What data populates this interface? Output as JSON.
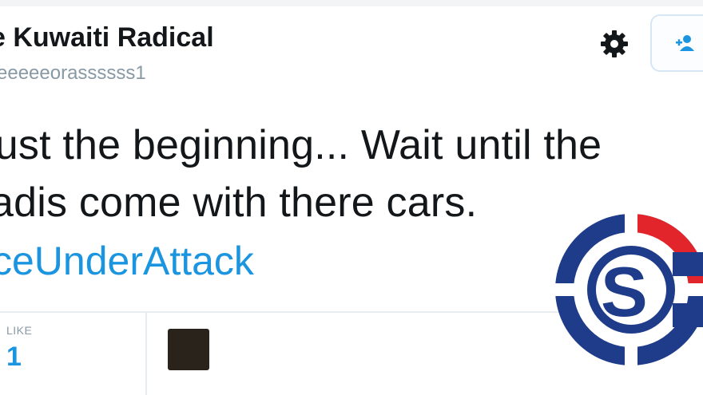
{
  "tweet": {
    "display_name": "e Kuwaiti Radical",
    "handle": "eeeeeorassssss1",
    "text_line_1": "just the beginning... Wait until the",
    "text_line_2": "adis come with there cars.",
    "hashtag": "ceUnderAttack",
    "likes_label": "LIKE",
    "likes_count": "1"
  },
  "icons": {
    "settings": "gear-icon",
    "follow": "follow-user-icon",
    "watermark": "si-logo"
  },
  "colors": {
    "accent": "#1b95e0",
    "text": "#14171a",
    "muted": "#8899a6",
    "logo_blue": "#1f3c8a",
    "logo_red": "#e2242b"
  }
}
